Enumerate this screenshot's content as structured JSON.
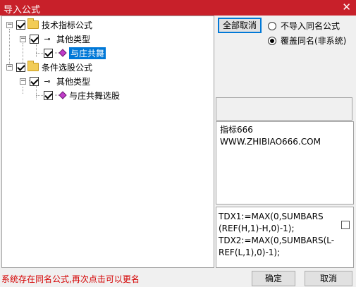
{
  "window": {
    "title": "导入公式",
    "close_glyph": "✕"
  },
  "tree": {
    "nodes": [
      {
        "label": "技术指标公式",
        "toggle": "−"
      },
      {
        "label": "其他类型",
        "toggle": "−",
        "icon": "⊸"
      },
      {
        "label": "与庄共舞"
      },
      {
        "label": "条件选股公式",
        "toggle": "−"
      },
      {
        "label": "其他类型",
        "toggle": "−",
        "icon": "⊸"
      },
      {
        "label": "与庄共舞选股"
      }
    ]
  },
  "options": {
    "clear_all_label": "全部取消",
    "radio_skip_label": "不导入同名公式",
    "radio_overwrite_label": "覆盖同名(非系统)",
    "selected": "overwrite"
  },
  "description": "指标666\nWWW.ZHIBIAO666.COM",
  "formula": "TDX1:=MAX(0,SUMBARS\n(REF(H,1)-H,0)-1);\nTDX2:=MAX(0,SUMBARS(L-\nREF(L,1),0)-1);",
  "status": "系统存在同名公式,再次点击可以更名",
  "buttons": {
    "ok": "确定",
    "cancel": "取消"
  },
  "colors": {
    "titlebar": "#c8202a",
    "selection": "#0078d7",
    "status_text": "#d40000"
  }
}
